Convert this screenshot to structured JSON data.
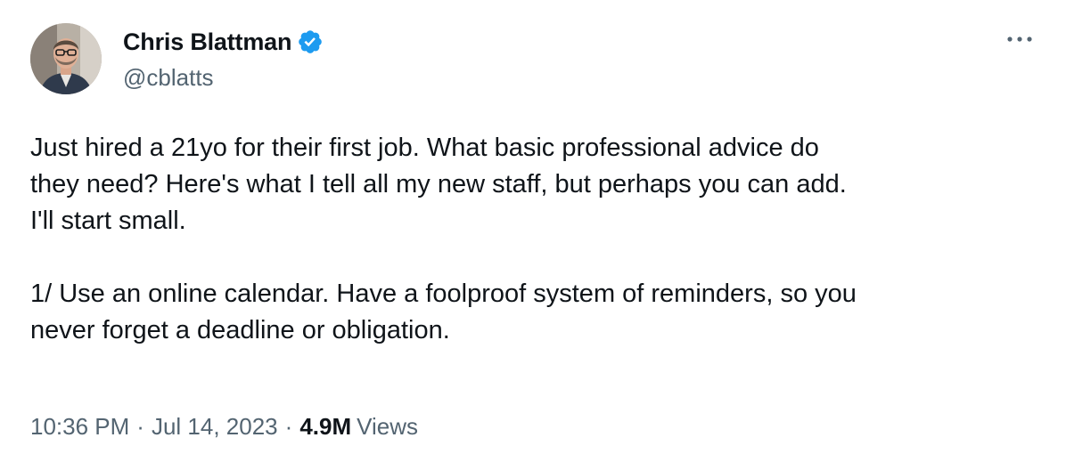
{
  "author": {
    "display_name": "Chris Blattman",
    "handle": "@cblatts",
    "verified_icon": "verified-badge-icon"
  },
  "tweet": {
    "text": "Just hired a 21yo for their first job. What basic professional advice do\nthey need? Here's what I tell all my new staff, but perhaps you can add.\nI'll start small.\n\n1/ Use an online calendar. Have a foolproof system of reminders, so you\nnever forget a deadline or obligation.",
    "time": "10:36 PM",
    "date": "Jul 14, 2023",
    "separator": "·",
    "views_count": "4.9M",
    "views_label": "Views"
  },
  "actions": {
    "more_icon": "more-options-icon"
  },
  "colors": {
    "accent": "#1d9bf0",
    "text_primary": "#0f1419",
    "text_secondary": "#536471"
  }
}
